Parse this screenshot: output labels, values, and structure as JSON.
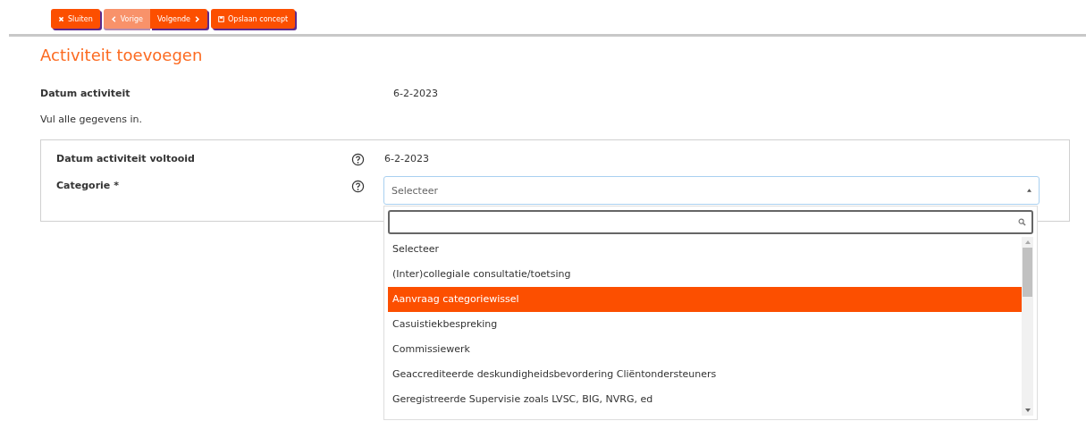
{
  "toolbar": [
    {
      "label": "Sluiten",
      "kind": "close",
      "disabled": false
    },
    {
      "label": "Vorige",
      "kind": "prev",
      "disabled": true
    },
    {
      "label": "Volgende",
      "kind": "next",
      "disabled": false
    },
    {
      "label": "Opslaan concept",
      "kind": "save",
      "disabled": false
    }
  ],
  "title": "Activiteit toevoegen",
  "date_row": {
    "label": "Datum activiteit",
    "value": "6-2-2023"
  },
  "instruction": "Vul alle gegevens in.",
  "form": {
    "completed": {
      "label": "Datum activiteit voltooid",
      "value": "6-2-2023"
    },
    "category": {
      "label": "Categorie *",
      "placeholder": "Selecteer",
      "expanded": true
    }
  },
  "dropdown": {
    "options": [
      {
        "label": "Selecteer",
        "selected": false
      },
      {
        "label": "(Inter)collegiale consultatie/toetsing",
        "selected": false
      },
      {
        "label": "Aanvraag categoriewissel",
        "selected": true
      },
      {
        "label": "Casuistiekbespreking",
        "selected": false
      },
      {
        "label": "Commissiewerk",
        "selected": false
      },
      {
        "label": "Geaccrediteerde deskundigheidsbevordering Cliëntondersteuners",
        "selected": false
      },
      {
        "label": "Geregistreerde Supervisie zoals LVSC, BIG, NVRG, ed",
        "selected": false
      }
    ]
  }
}
